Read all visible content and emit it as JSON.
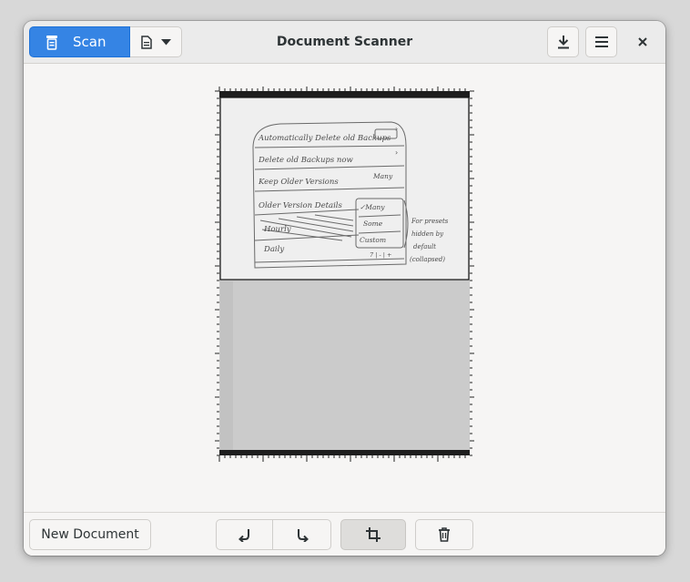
{
  "window": {
    "title": "Document Scanner"
  },
  "header": {
    "scan_label": "Scan",
    "scan_icon": "scanner-icon",
    "doc_type_icon": "document-icon",
    "download_icon": "download-icon",
    "menu_icon": "hamburger-menu-icon",
    "close_icon": "close-icon",
    "accent_color": "#3584e4"
  },
  "page": {
    "sketch_lines": [
      "Automatically Delete old Backups",
      "Delete old Backups now",
      "Keep Older Versions",
      "Older Version Details",
      "Hourly",
      "Daily"
    ],
    "sketch_dropdown_value": "Many",
    "sketch_popover_options": [
      "✓Many",
      "Some",
      "Custom"
    ],
    "sketch_daily_value": "7 | - | +",
    "sketch_note": [
      "For presets",
      "hidden by",
      "default",
      "(collapsed)"
    ]
  },
  "actions": {
    "new_document_label": "New Document",
    "rotate_left_icon": "rotate-left-icon",
    "rotate_right_icon": "rotate-right-icon",
    "crop_icon": "crop-icon",
    "delete_icon": "trash-icon"
  }
}
